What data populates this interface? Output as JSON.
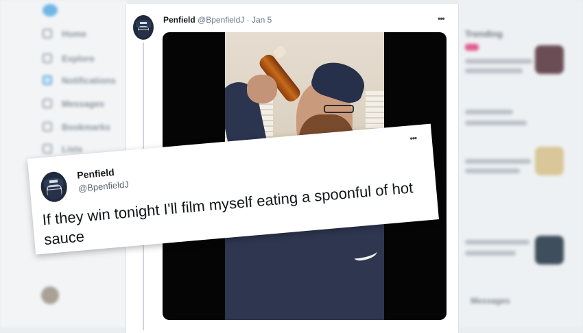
{
  "background": {
    "sidebar": {
      "items": [
        {
          "label": "Home",
          "icon": "home-icon"
        },
        {
          "label": "Explore",
          "icon": "hashtag-icon"
        },
        {
          "label": "Notifications",
          "icon": "bell-icon"
        },
        {
          "label": "Messages",
          "icon": "mail-icon"
        },
        {
          "label": "Bookmarks",
          "icon": "bookmark-icon"
        },
        {
          "label": "Lists",
          "icon": "list-icon"
        }
      ]
    },
    "right": {
      "heading": "Trending",
      "messages_label": "Messages"
    }
  },
  "tweet": {
    "author_name": "Penfield",
    "handle": "@BpenfieldJ",
    "separator": "·",
    "date": "Jan 5",
    "more": "•••"
  },
  "quote": {
    "author_name": "Penfield",
    "handle": "@BpenfieldJ",
    "more": "•••",
    "text": "If they win tonight I'll film myself eating a spoonful of hot sauce"
  },
  "colors": {
    "accent": "#1da1f2",
    "card_bg": "#ffffff",
    "page_bg": "#e9edf0"
  }
}
